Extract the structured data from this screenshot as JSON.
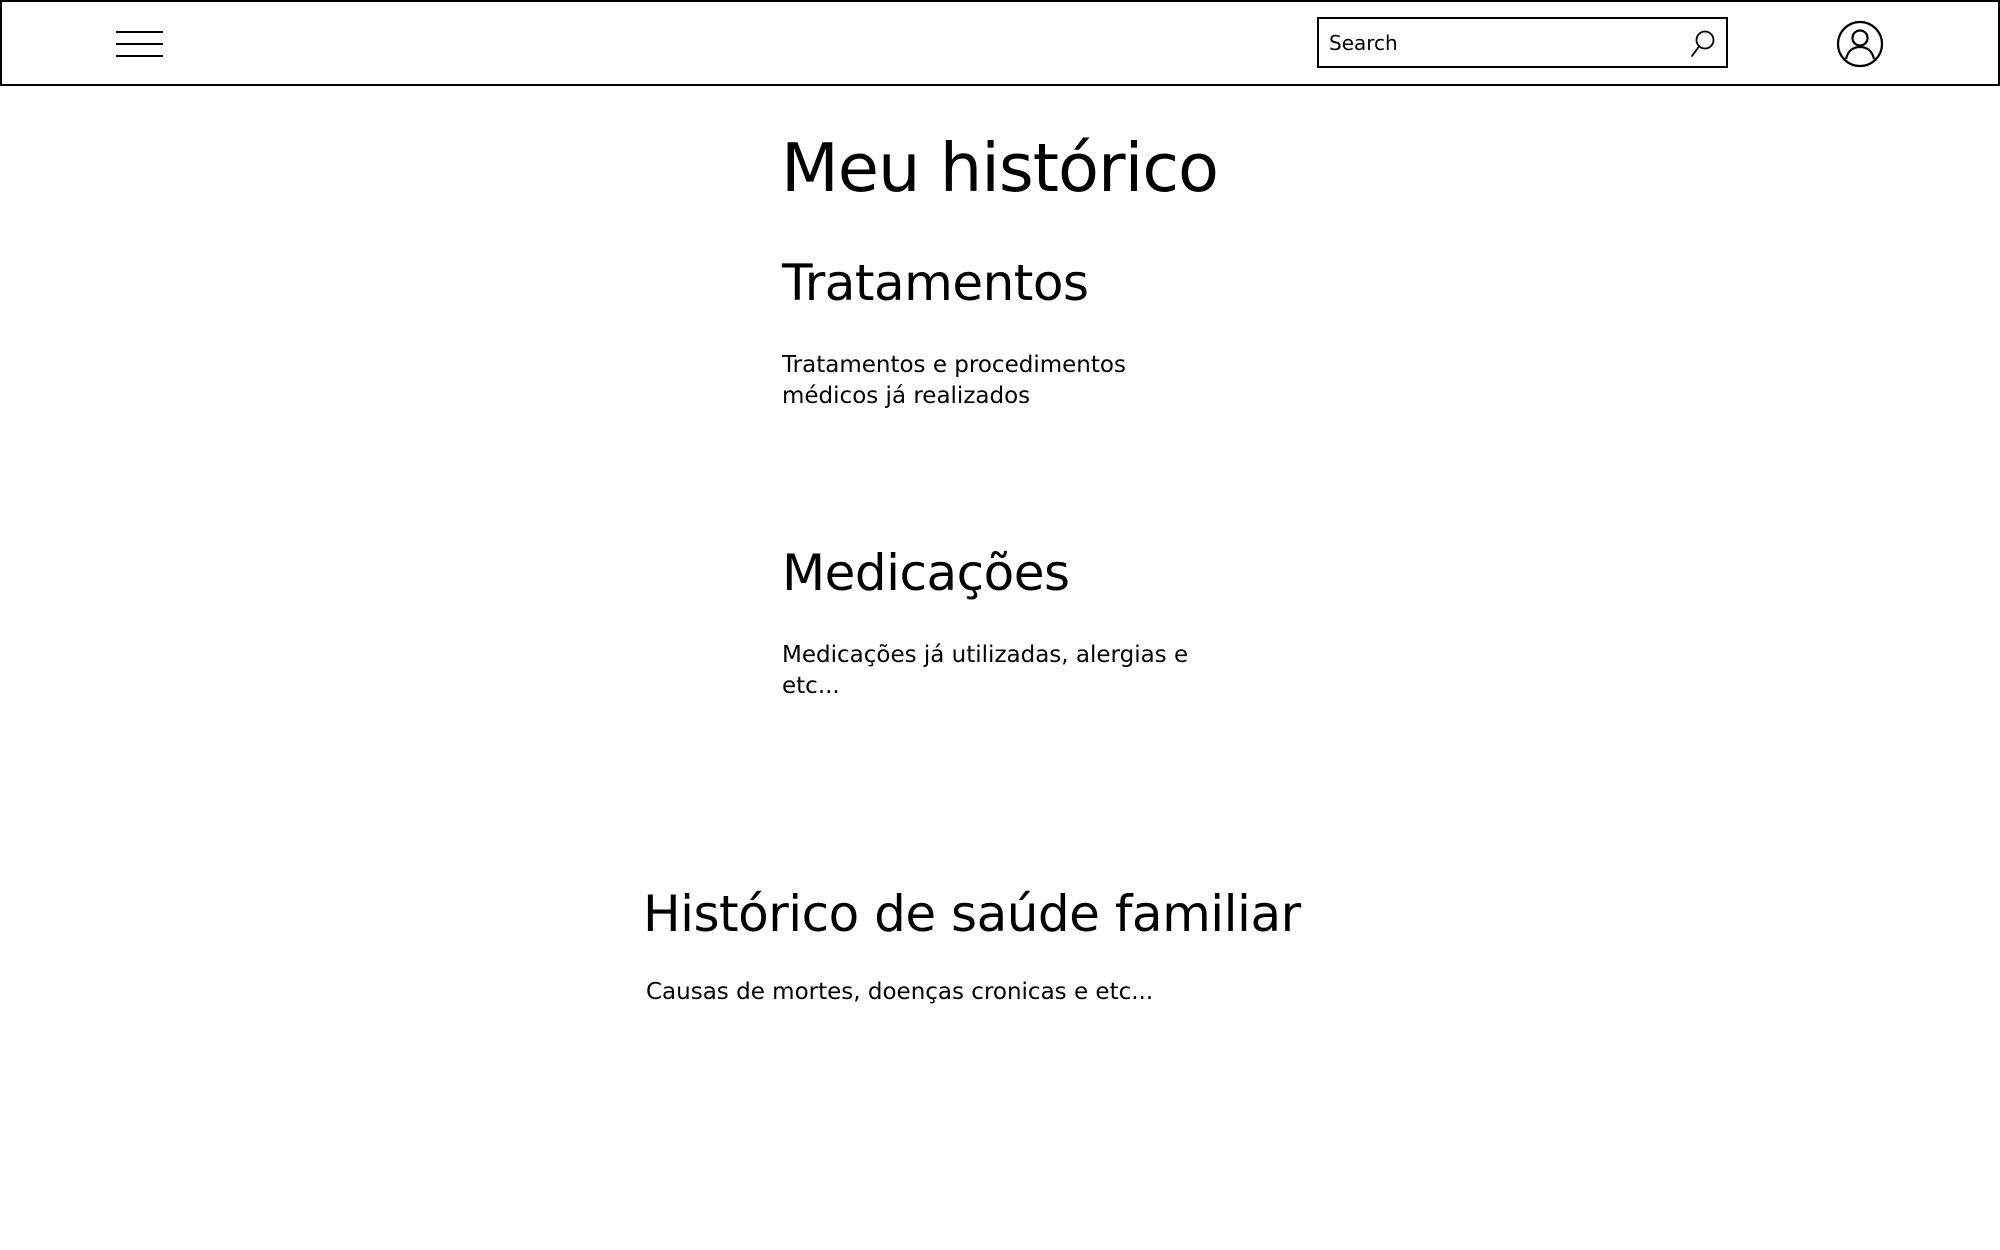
{
  "header": {
    "menu_icon": "hamburger-menu-icon",
    "search": {
      "placeholder": "Search",
      "value": "",
      "icon": "search-icon"
    },
    "user_icon": "user-account-icon"
  },
  "page": {
    "title": "Meu histórico"
  },
  "sections": [
    {
      "title": "Tratamentos",
      "description": "Tratamentos e procedimentos médicos já realizados"
    },
    {
      "title": "Medicações",
      "description": "Medicações já utilizadas, alergias e etc..."
    },
    {
      "title": "Histórico de saúde familiar",
      "description": "Causas de mortes, doenças cronicas e etc..."
    }
  ]
}
